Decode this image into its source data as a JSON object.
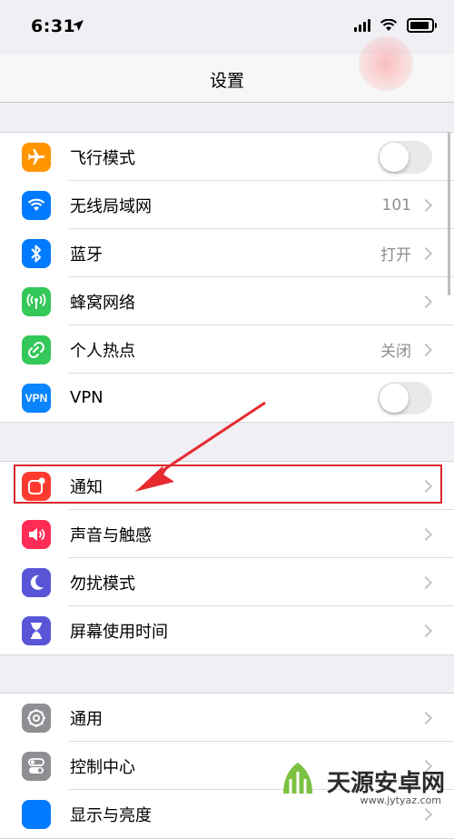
{
  "status": {
    "time": "6:31"
  },
  "navbar": {
    "title": "设置"
  },
  "groups": [
    {
      "items": [
        {
          "label": "飞行模式",
          "value": "",
          "control": "toggle",
          "toggle_on": false,
          "icon": "airplane-icon",
          "color": "#ff9500"
        },
        {
          "label": "无线局域网",
          "value": "101",
          "control": "chevron",
          "icon": "wifi-icon",
          "color": "#007aff"
        },
        {
          "label": "蓝牙",
          "value": "打开",
          "control": "chevron",
          "icon": "bluetooth-icon",
          "color": "#007aff"
        },
        {
          "label": "蜂窝网络",
          "value": "",
          "control": "chevron",
          "icon": "antenna-icon",
          "color": "#34c759"
        },
        {
          "label": "个人热点",
          "value": "关闭",
          "control": "chevron",
          "icon": "hotspot-icon",
          "color": "#34c759"
        },
        {
          "label": "VPN",
          "value": "",
          "control": "toggle",
          "toggle_on": false,
          "icon": "vpn-icon",
          "icon_text": "VPN",
          "color": "#0a84ff"
        }
      ]
    },
    {
      "items": [
        {
          "label": "通知",
          "value": "",
          "control": "chevron",
          "icon": "notifications-icon",
          "color": "#ff3b30"
        },
        {
          "label": "声音与触感",
          "value": "",
          "control": "chevron",
          "icon": "speaker-icon",
          "color": "#ff2d55"
        },
        {
          "label": "勿扰模式",
          "value": "",
          "control": "chevron",
          "icon": "moon-icon",
          "color": "#5856d6"
        },
        {
          "label": "屏幕使用时间",
          "value": "",
          "control": "chevron",
          "icon": "hourglass-icon",
          "color": "#5856d6"
        }
      ]
    },
    {
      "items": [
        {
          "label": "通用",
          "value": "",
          "control": "chevron",
          "icon": "gear-icon",
          "color": "#8e8e93"
        },
        {
          "label": "控制中心",
          "value": "",
          "control": "chevron",
          "icon": "switches-icon",
          "color": "#8e8e93"
        },
        {
          "label": "显示与亮度",
          "value": "",
          "control": "chevron",
          "icon": "display-icon",
          "color": "#007aff"
        }
      ]
    }
  ],
  "annotation": {
    "highlight_color": "#d9272e"
  },
  "watermark": {
    "text": "天源安卓网",
    "url": "www.jytyaz.com"
  }
}
